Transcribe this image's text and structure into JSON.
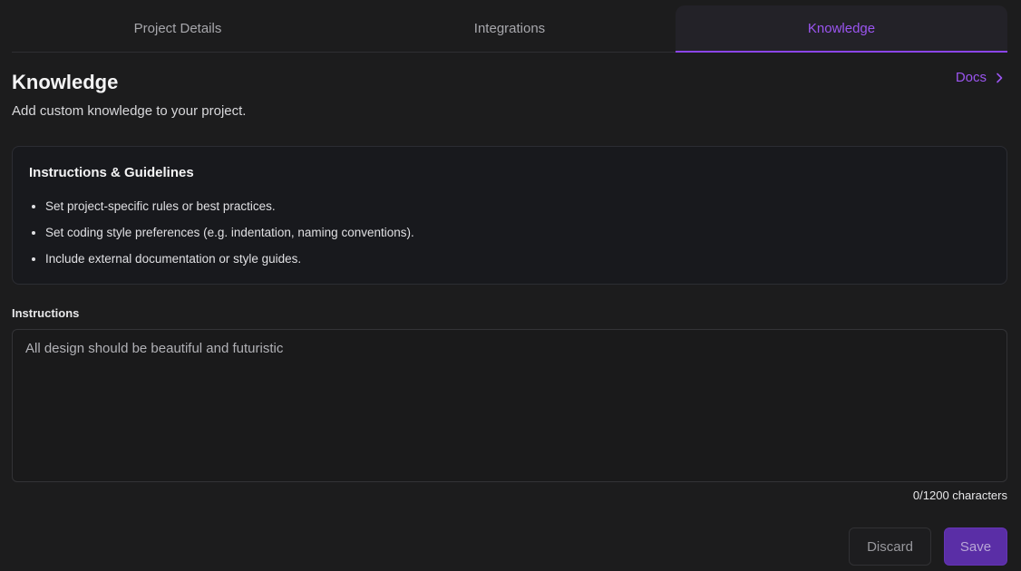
{
  "tabs": [
    {
      "label": "Project Details",
      "active": false
    },
    {
      "label": "Integrations",
      "active": false
    },
    {
      "label": "Knowledge",
      "active": true
    }
  ],
  "header": {
    "title": "Knowledge",
    "subtitle": "Add custom knowledge to your project.",
    "docs_label": "Docs",
    "docs_icon": "chevron-right-icon"
  },
  "guidelines": {
    "title": "Instructions & Guidelines",
    "items": [
      "Set project-specific rules or best practices.",
      "Set coding style preferences (e.g. indentation, naming conventions).",
      "Include external documentation or style guides."
    ]
  },
  "instructions": {
    "label": "Instructions",
    "value": "All design should be beautiful and futuristic",
    "char_count": "0/1200 characters"
  },
  "actions": {
    "discard_label": "Discard",
    "save_label": "Save"
  },
  "colors": {
    "accent": "#9b55f0",
    "background": "#1c1c1d",
    "save_button": "#5a2ea6"
  }
}
